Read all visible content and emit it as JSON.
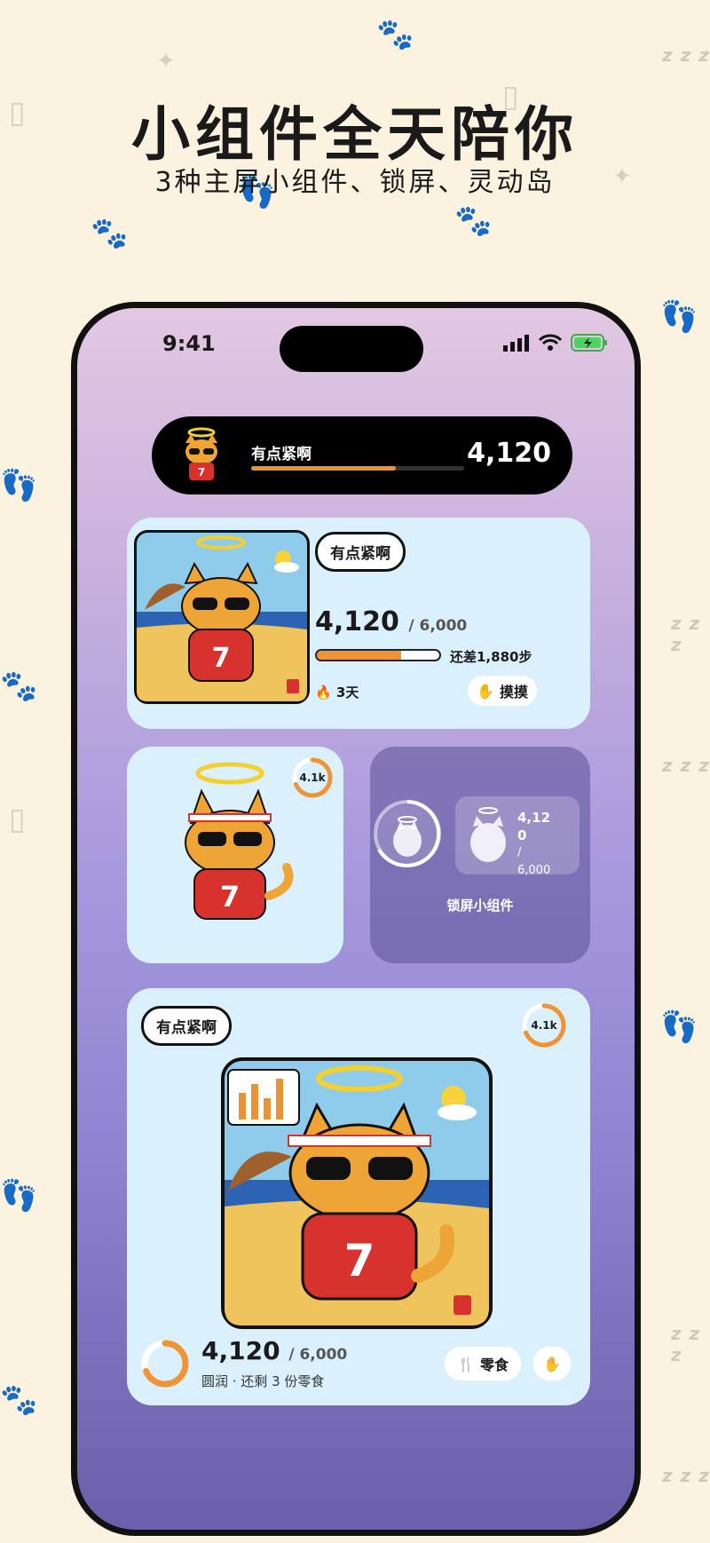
{
  "headline": "小组件全天陪你",
  "subline": "3种主屏小组件、锁屏、灵动岛",
  "status_bar": {
    "time": "9:41"
  },
  "dynamic_island": {
    "status": "有点紧啊",
    "steps": "4,120",
    "progress": 0.68
  },
  "medium_widget": {
    "mood": "有点紧啊",
    "steps": "4,120",
    "goal": "/ 6,000",
    "progress": 0.69,
    "remaining": "还差1,880步",
    "streak": "3天",
    "pet_button": "摸摸"
  },
  "small_widget": {
    "ring_label": "4.1k",
    "progress": 0.69
  },
  "lock_widget": {
    "label": "锁屏小组件",
    "steps_line1": "4,12",
    "steps_line2": "0",
    "goal_line1": "/",
    "goal_line2": "6,000"
  },
  "large_widget": {
    "mood": "有点紧啊",
    "ring_label": "4.1k",
    "steps": "4,120",
    "goal": "/ 6,000",
    "subtitle": "圆润 · 还剩 3 份零食",
    "snack_button": "零食",
    "progress": 0.69
  },
  "colors": {
    "accent": "#ee9436",
    "card": "#daf0fc",
    "background": "#fbf3df"
  }
}
